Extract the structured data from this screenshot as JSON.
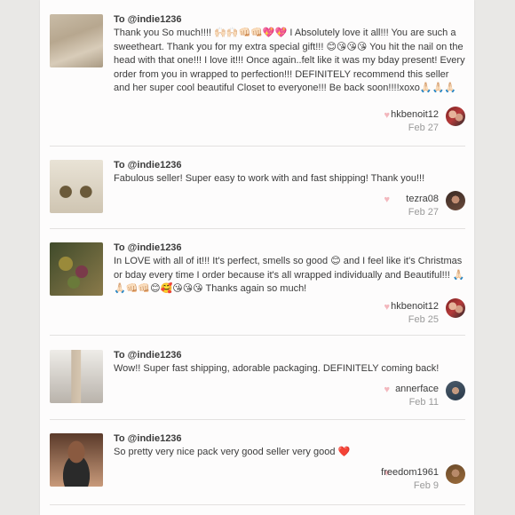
{
  "reviews": [
    {
      "to": "To @indie1236",
      "text": "Thank you So much!!!! 🙌🏻🙌🏻👊🏻👊🏻💖💖 I Absolutely love it all!!! You are such a sweetheart. Thank you for my extra special gift!!! 😊😘😘😘 You hit the nail on the head with that one!!! I love it!!! Once again..felt like it was my bday present! Every order from you in wrapped to perfection!!! DEFINITELY recommend this seller and her super cool beautiful Closet to everyone!!! Be back soon!!!!xoxo🙏🏻🙏🏻🙏🏻",
      "user": "hkbenoit12",
      "date": "Feb 27",
      "thumb_icon": "jeans-photo",
      "avatar_icon": "couple-avatar"
    },
    {
      "to": "To @indie1236",
      "text": "Fabulous seller! Super easy to work with and fast shipping! Thank you!!!",
      "user": "tezra08",
      "date": "Feb 27",
      "thumb_icon": "earrings-photo",
      "avatar_icon": "woman-avatar"
    },
    {
      "to": "To @indie1236",
      "text": "In LOVE with all of it!!! It's perfect, smells so good 😊 and I feel like it's Christmas or bday every time I order because it's all wrapped individually and Beautiful!!! 🙏🏻🙏🏻👊🏻👊🏻😊🥰😘😘😘 Thanks again so much!",
      "user": "hkbenoit12",
      "date": "Feb 25",
      "thumb_icon": "bracelets-photo",
      "avatar_icon": "couple-avatar"
    },
    {
      "to": "To @indie1236",
      "text": "Wow!! Super fast shipping, adorable packaging. DEFINITELY coming back!",
      "user": "annerface",
      "date": "Feb 11",
      "thumb_icon": "outfit-photo",
      "avatar_icon": "person-avatar"
    },
    {
      "to": "To @indie1236",
      "text": "So pretty very nice pack very good seller very good ❤️",
      "user": "freedom1961",
      "date": "Feb 9",
      "thumb_icon": "necklace-photo",
      "avatar_icon": "woman-avatar"
    }
  ],
  "colors": {
    "heart": "#f3b7bd",
    "text": "#3b3b3b",
    "muted": "#9a9a9a",
    "divider": "#e3e1e0"
  }
}
